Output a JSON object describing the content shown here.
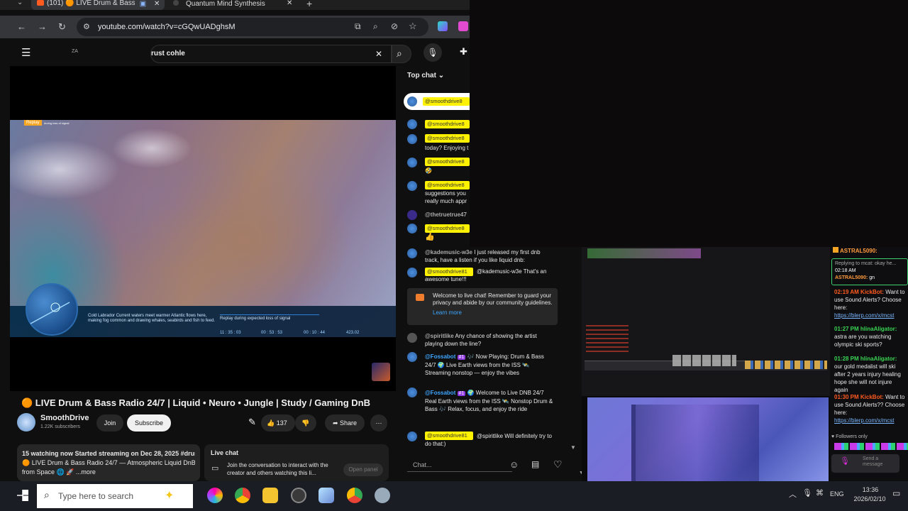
{
  "browser": {
    "tabs": [
      {
        "label": "(101) 🟠 LIVE Drum & Bass",
        "active": true
      },
      {
        "label": "Quantum Mind Synthesis",
        "active": false
      }
    ],
    "url": "youtube.com/watch?v=cGQwUADghsM"
  },
  "youtube": {
    "search_value": "rust cohle",
    "menu_text": "ZA",
    "player": {
      "replay_badge": "Replay",
      "replay_sub": "during loss of signal",
      "caption": "Cold Labrador Current waters meet warmer Atlantic flows here, making fog common and drawing whales, seabirds and fish to feed.",
      "overlay_label": "Replay during expected loss of signal",
      "stats": [
        "11 : 35 : 03",
        "00 : 53 : 53",
        "00 : 10 : 44",
        "423.02"
      ]
    },
    "video_title": "🟠 LIVE Drum & Bass Radio 24/7 | Liquid • Neuro • Jungle | Study / Gaming DnB",
    "channel": {
      "name": "SmoothDrive",
      "subscribers": "1.22K subscribers"
    },
    "buttons": {
      "join": "Join",
      "subscribe": "Subscribe",
      "likes": "137",
      "share": "Share"
    },
    "description": {
      "line1": "15 watching now  Started streaming on Dec 28, 2025  #drum",
      "line2": "🟠 LIVE Drum & Bass Radio 24/7 — Atmospheric Liquid DnB",
      "line3": "from Space 🌐 🚀 ...more"
    },
    "livechat_card": {
      "title": "Live chat",
      "text": "Join the conversation to interact with the creator and others watching this li...",
      "open_panel": "Open panel"
    }
  },
  "chat": {
    "header": "Top chat",
    "messages": [
      {
        "author": "@smoothdrive8",
        "text": ""
      },
      {
        "author": "@smoothdrive8",
        "text": ""
      },
      {
        "author": "@smoothdrive8",
        "text": "today? Enjoying t"
      },
      {
        "author": "@smoothdrive8",
        "text": "🤣"
      },
      {
        "author": "@smoothdrive8",
        "text": "suggestions you really much appr"
      },
      {
        "author": "@thetruetrue47",
        "text": ""
      },
      {
        "author": "@smoothdrive8",
        "text": "👍"
      }
    ],
    "messages_ext": [
      {
        "author": "@kademusic-w3e",
        "text": "I just released my first dnb track, have a listen if you like liquid dnb:"
      },
      {
        "author": "@smoothdrive81",
        "text": "@kademusic-w3e That's an awesome tune!!!"
      },
      {
        "author": "@spiritlike",
        "text": "Any chance of showing the artist playing down the line?"
      },
      {
        "author": "@Fossabot",
        "text": "🎶 Now Playing: Drum & Bass 24/7 🌍 Live Earth views from the ISS 🛰️ Streaming nonstop — enjoy the vibes"
      },
      {
        "author": "@Fossabot",
        "text": "🌍 Welcome to Live DNB 24/7 Real Earth views from the ISS 🛰️ Nonstop Drum & Bass 🎶 Relax, focus, and enjoy the ride"
      },
      {
        "author": "@smoothdrive81",
        "text": "@spiritlike Will definitely try to do that:)"
      }
    ],
    "welcome": "Welcome to live chat! Remember to guard your privacy and abide by our community guidelines.",
    "learn_more": "Learn more",
    "input_placeholder": "Chat...",
    "badge": "#1"
  },
  "twitch": {
    "lines": [
      {
        "author": "ASTRAL5090:",
        "text": ""
      },
      {
        "author": "",
        "text": "Replying to mcat: okay he..."
      },
      {
        "author": "02:18 AM",
        "text": ""
      },
      {
        "author": "ASTRAL5090:",
        "text": "gn"
      },
      {
        "author": "02:19 AM KickBot:",
        "text": "Want to use Sound Alerts? Choose here:"
      },
      {
        "author": "",
        "text": "https://blerp.com/x/mcst"
      },
      {
        "author": "01:27 PM hlinaAligator:",
        "text": "astra are you watching olympic ski sports?"
      },
      {
        "author": "01:28 PM hlinaAligator:",
        "text": "our gold medalist will ski after 2 years injury healing hope she will not injure again"
      },
      {
        "author": "01:30 PM KickBot:",
        "text": "Want to use Sound Alerts?? Choose here:"
      },
      {
        "author": "",
        "text": "https://blerp.com/x/mcst"
      }
    ],
    "followers_only": "Followers only",
    "send_message": "Send a message"
  },
  "taskbar": {
    "search_placeholder": "Type here to search",
    "lang": "ENG",
    "time": "13:36",
    "date": "2026/02/10"
  },
  "colors": {
    "accent_red": "#ff0000",
    "chat_highlight": "#fef200",
    "link_blue": "#3ea6ff",
    "twitch_purple": "#9146ff"
  }
}
